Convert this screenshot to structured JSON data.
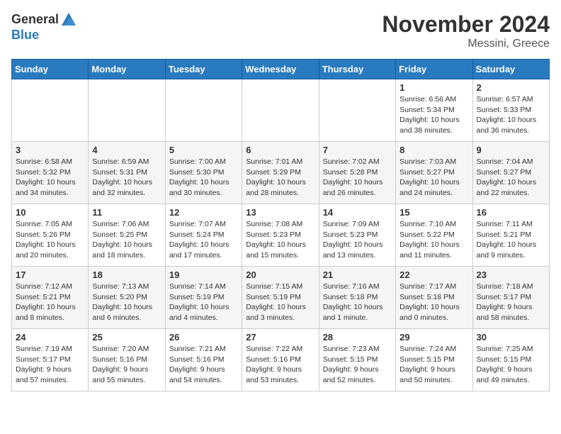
{
  "logo": {
    "general": "General",
    "blue": "Blue"
  },
  "title": "November 2024",
  "location": "Messini, Greece",
  "days_of_week": [
    "Sunday",
    "Monday",
    "Tuesday",
    "Wednesday",
    "Thursday",
    "Friday",
    "Saturday"
  ],
  "weeks": [
    [
      {
        "num": "",
        "info": ""
      },
      {
        "num": "",
        "info": ""
      },
      {
        "num": "",
        "info": ""
      },
      {
        "num": "",
        "info": ""
      },
      {
        "num": "",
        "info": ""
      },
      {
        "num": "1",
        "info": "Sunrise: 6:56 AM\nSunset: 5:34 PM\nDaylight: 10 hours\nand 38 minutes."
      },
      {
        "num": "2",
        "info": "Sunrise: 6:57 AM\nSunset: 5:33 PM\nDaylight: 10 hours\nand 36 minutes."
      }
    ],
    [
      {
        "num": "3",
        "info": "Sunrise: 6:58 AM\nSunset: 5:32 PM\nDaylight: 10 hours\nand 34 minutes."
      },
      {
        "num": "4",
        "info": "Sunrise: 6:59 AM\nSunset: 5:31 PM\nDaylight: 10 hours\nand 32 minutes."
      },
      {
        "num": "5",
        "info": "Sunrise: 7:00 AM\nSunset: 5:30 PM\nDaylight: 10 hours\nand 30 minutes."
      },
      {
        "num": "6",
        "info": "Sunrise: 7:01 AM\nSunset: 5:29 PM\nDaylight: 10 hours\nand 28 minutes."
      },
      {
        "num": "7",
        "info": "Sunrise: 7:02 AM\nSunset: 5:28 PM\nDaylight: 10 hours\nand 26 minutes."
      },
      {
        "num": "8",
        "info": "Sunrise: 7:03 AM\nSunset: 5:27 PM\nDaylight: 10 hours\nand 24 minutes."
      },
      {
        "num": "9",
        "info": "Sunrise: 7:04 AM\nSunset: 5:27 PM\nDaylight: 10 hours\nand 22 minutes."
      }
    ],
    [
      {
        "num": "10",
        "info": "Sunrise: 7:05 AM\nSunset: 5:26 PM\nDaylight: 10 hours\nand 20 minutes."
      },
      {
        "num": "11",
        "info": "Sunrise: 7:06 AM\nSunset: 5:25 PM\nDaylight: 10 hours\nand 18 minutes."
      },
      {
        "num": "12",
        "info": "Sunrise: 7:07 AM\nSunset: 5:24 PM\nDaylight: 10 hours\nand 17 minutes."
      },
      {
        "num": "13",
        "info": "Sunrise: 7:08 AM\nSunset: 5:23 PM\nDaylight: 10 hours\nand 15 minutes."
      },
      {
        "num": "14",
        "info": "Sunrise: 7:09 AM\nSunset: 5:23 PM\nDaylight: 10 hours\nand 13 minutes."
      },
      {
        "num": "15",
        "info": "Sunrise: 7:10 AM\nSunset: 5:22 PM\nDaylight: 10 hours\nand 11 minutes."
      },
      {
        "num": "16",
        "info": "Sunrise: 7:11 AM\nSunset: 5:21 PM\nDaylight: 10 hours\nand 9 minutes."
      }
    ],
    [
      {
        "num": "17",
        "info": "Sunrise: 7:12 AM\nSunset: 5:21 PM\nDaylight: 10 hours\nand 8 minutes."
      },
      {
        "num": "18",
        "info": "Sunrise: 7:13 AM\nSunset: 5:20 PM\nDaylight: 10 hours\nand 6 minutes."
      },
      {
        "num": "19",
        "info": "Sunrise: 7:14 AM\nSunset: 5:19 PM\nDaylight: 10 hours\nand 4 minutes."
      },
      {
        "num": "20",
        "info": "Sunrise: 7:15 AM\nSunset: 5:19 PM\nDaylight: 10 hours\nand 3 minutes."
      },
      {
        "num": "21",
        "info": "Sunrise: 7:16 AM\nSunset: 5:18 PM\nDaylight: 10 hours\nand 1 minute."
      },
      {
        "num": "22",
        "info": "Sunrise: 7:17 AM\nSunset: 5:18 PM\nDaylight: 10 hours\nand 0 minutes."
      },
      {
        "num": "23",
        "info": "Sunrise: 7:18 AM\nSunset: 5:17 PM\nDaylight: 9 hours\nand 58 minutes."
      }
    ],
    [
      {
        "num": "24",
        "info": "Sunrise: 7:19 AM\nSunset: 5:17 PM\nDaylight: 9 hours\nand 57 minutes."
      },
      {
        "num": "25",
        "info": "Sunrise: 7:20 AM\nSunset: 5:16 PM\nDaylight: 9 hours\nand 55 minutes."
      },
      {
        "num": "26",
        "info": "Sunrise: 7:21 AM\nSunset: 5:16 PM\nDaylight: 9 hours\nand 54 minutes."
      },
      {
        "num": "27",
        "info": "Sunrise: 7:22 AM\nSunset: 5:16 PM\nDaylight: 9 hours\nand 53 minutes."
      },
      {
        "num": "28",
        "info": "Sunrise: 7:23 AM\nSunset: 5:15 PM\nDaylight: 9 hours\nand 52 minutes."
      },
      {
        "num": "29",
        "info": "Sunrise: 7:24 AM\nSunset: 5:15 PM\nDaylight: 9 hours\nand 50 minutes."
      },
      {
        "num": "30",
        "info": "Sunrise: 7:25 AM\nSunset: 5:15 PM\nDaylight: 9 hours\nand 49 minutes."
      }
    ]
  ]
}
